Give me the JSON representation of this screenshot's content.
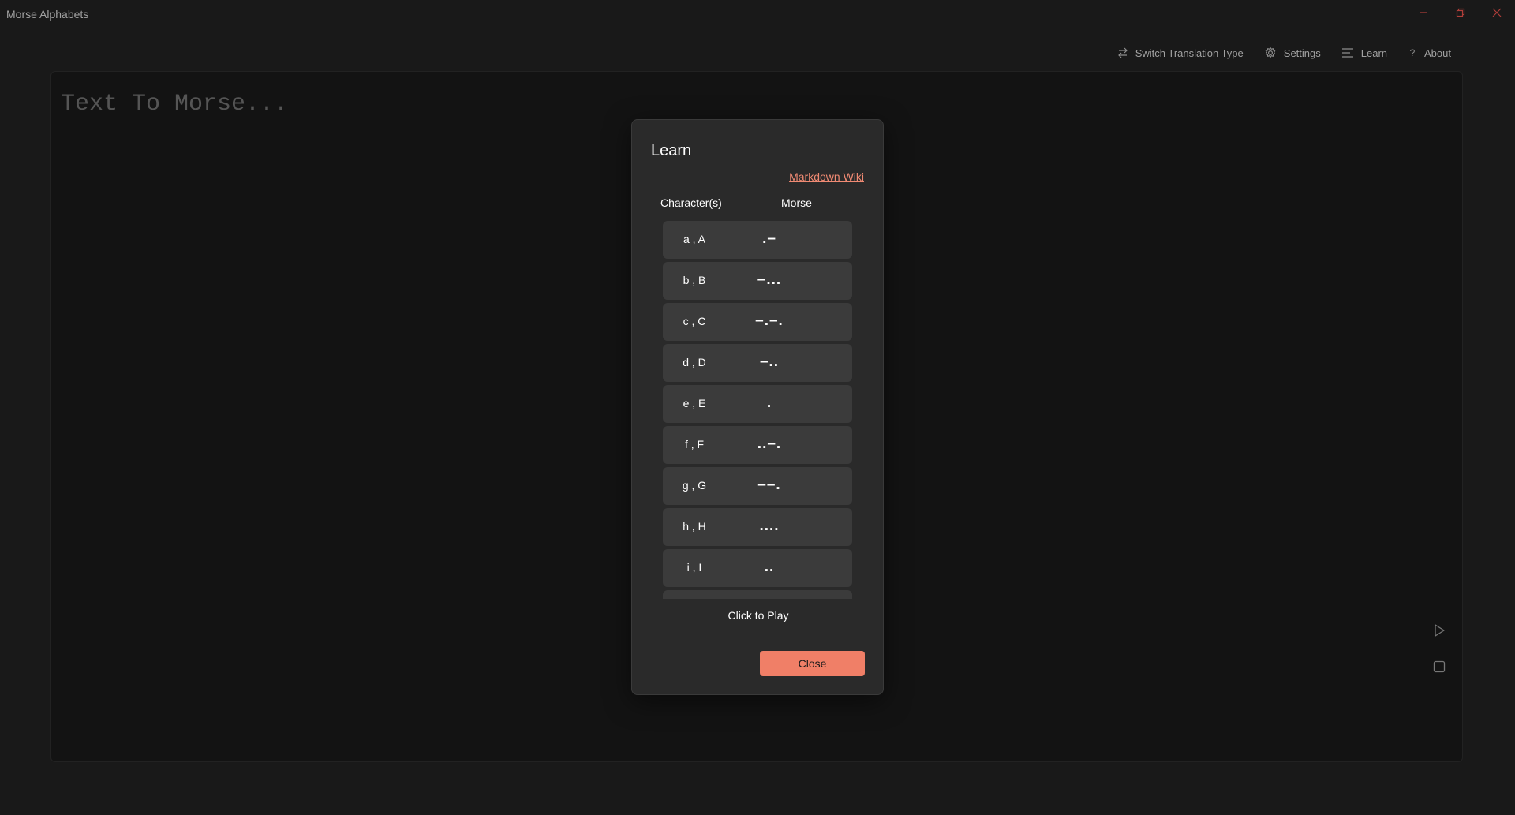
{
  "window": {
    "title": "Morse Alphabets"
  },
  "nav": {
    "switch": "Switch Translation Type",
    "settings": "Settings",
    "learn": "Learn",
    "about": "About"
  },
  "editor": {
    "placeholder": "Text To Morse..."
  },
  "dialog": {
    "title": "Learn",
    "wiki_link": "Markdown Wiki",
    "col_chars": "Character(s)",
    "col_morse": "Morse",
    "rows": [
      {
        "chars": "a , A",
        "morse": ".–"
      },
      {
        "chars": "b , B",
        "morse": "–..."
      },
      {
        "chars": "c , C",
        "morse": "–.–."
      },
      {
        "chars": "d , D",
        "morse": "–.."
      },
      {
        "chars": "e , E",
        "morse": "."
      },
      {
        "chars": "f , F",
        "morse": "..–."
      },
      {
        "chars": "g , G",
        "morse": "––."
      },
      {
        "chars": "h , H",
        "morse": "...."
      },
      {
        "chars": "i , I",
        "morse": ".."
      },
      {
        "chars": "",
        "morse": ""
      }
    ],
    "click_hint": "Click to Play",
    "close_label": "Close"
  },
  "colors": {
    "accent": "#f07f67",
    "background": "#202020",
    "dialog_bg": "#2a2a2a",
    "row_bg": "#3b3b3b",
    "window_controls": "#e2504a"
  },
  "icons": {
    "minimize": "minimize-icon",
    "maximize": "restore-icon",
    "close": "close-icon",
    "switch": "swap-arrows-icon",
    "settings": "gear-icon",
    "learn": "menu-lines-icon",
    "about": "question-icon",
    "play": "play-icon",
    "stop": "stop-icon"
  }
}
